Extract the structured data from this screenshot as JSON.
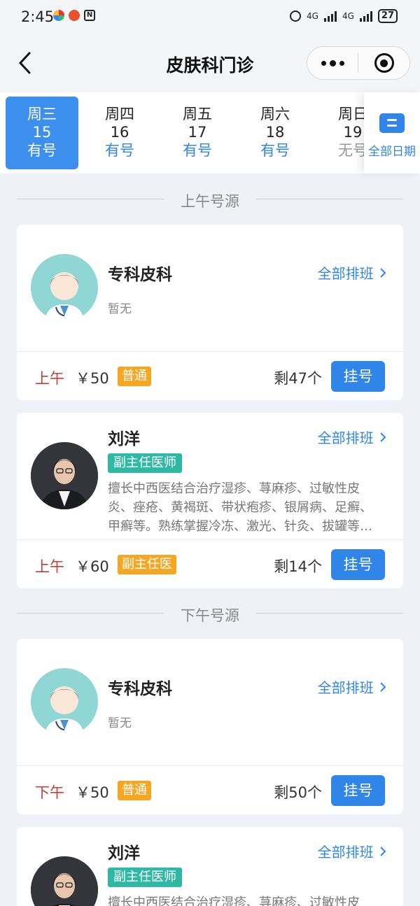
{
  "status_bar": {
    "time": "2:45",
    "net1": "4G",
    "net2": "4G",
    "battery": "27"
  },
  "nav": {
    "title": "皮肤科门诊"
  },
  "dates": [
    {
      "weekday": "周三",
      "day": "15",
      "status": "有号"
    },
    {
      "weekday": "周四",
      "day": "16",
      "status": "有号"
    },
    {
      "weekday": "周五",
      "day": "17",
      "status": "有号"
    },
    {
      "weekday": "周六",
      "day": "18",
      "status": "有号"
    },
    {
      "weekday": "周日",
      "day": "19",
      "status": "无号"
    }
  ],
  "all_dates_label": "全部日期",
  "morning": {
    "header": "上午号源",
    "cards": [
      {
        "name": "专科皮科",
        "schedule": "全部排班",
        "desc": "暂无",
        "period": "上午",
        "price": "￥50",
        "fee_type": "普通",
        "remain": "剩47个",
        "button": "挂号"
      },
      {
        "name": "刘洋",
        "schedule": "全部排班",
        "title": "副主任医师",
        "specialty": "擅长中西医结合治疗湿疹、荨麻疹、过敏性皮炎、痤疮、黄褐斑、带状疱疹、银屑病、足癣、甲癣等。熟练掌握冷冻、激光、针灸、拔罐等…",
        "period": "上午",
        "price": "￥60",
        "fee_type": "副主任医",
        "remain": "剩14个",
        "button": "挂号"
      }
    ]
  },
  "afternoon": {
    "header": "下午号源",
    "cards": [
      {
        "name": "专科皮科",
        "schedule": "全部排班",
        "desc": "暂无",
        "period": "下午",
        "price": "￥50",
        "fee_type": "普通",
        "remain": "剩50个",
        "button": "挂号"
      },
      {
        "name": "刘洋",
        "schedule": "全部排班",
        "title": "副主任医师",
        "specialty": "擅长中西医结合治疗湿疹、荨麻疹、过敏性皮"
      }
    ]
  },
  "colors": {
    "accent": "#2f86e8",
    "morning_label": "#c0403a",
    "fee_badge": "#f5a623",
    "title_badge": "#2fb8a4"
  },
  "icons": [
    "back-arrow-icon",
    "more-icon",
    "close-ring-icon",
    "calendar-icon",
    "chevron-right-icon",
    "default-doctor-avatar",
    "doctor-photo"
  ]
}
